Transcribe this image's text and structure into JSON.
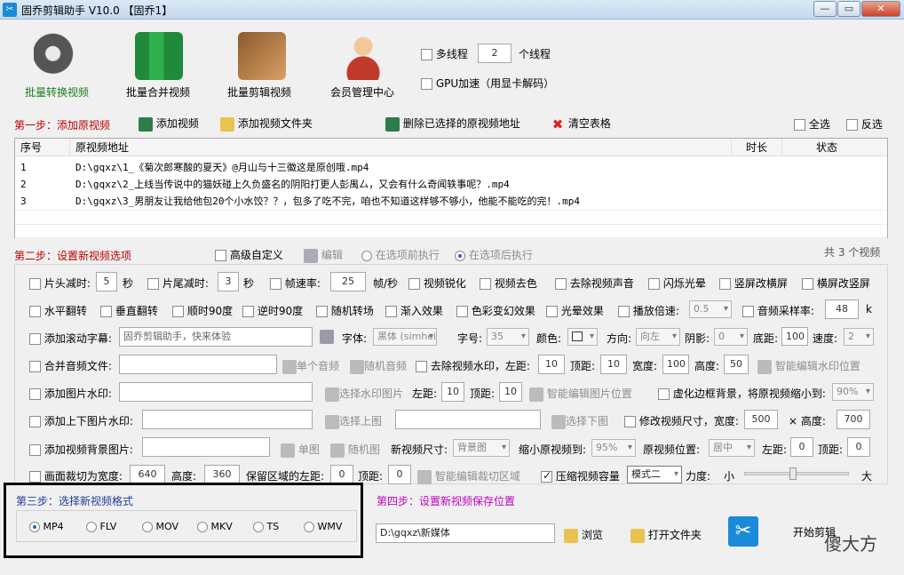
{
  "window": {
    "title": "固乔剪辑助手 V10.0 【固乔1】"
  },
  "topnav": [
    {
      "label": "批量转换视频",
      "icon": "film-reel-icon",
      "color": "#1a7f1a"
    },
    {
      "label": "批量合并视频",
      "icon": "merge-grid-icon",
      "color": "#000000"
    },
    {
      "label": "批量剪辑视频",
      "icon": "film-cut-icon",
      "color": "#000000"
    },
    {
      "label": "会员管理中心",
      "icon": "users-icon",
      "color": "#000000"
    }
  ],
  "thread": {
    "multithread_label": "多线程",
    "count": "2",
    "count_unit": "个线程",
    "gpu_label": "GPU加速（用显卡解码）"
  },
  "step1": {
    "prefix": "第一步：",
    "label": "添加原视频",
    "add_video": "添加视频",
    "add_folder": "添加视频文件夹",
    "delete_selected": "删除已选择的原视频地址",
    "clear_table": "清空表格",
    "select_all": "全选",
    "invert": "反选"
  },
  "table": {
    "headers": [
      "序号",
      "原视频地址",
      "时长",
      "状态"
    ],
    "rows": [
      {
        "idx": "1",
        "path": "D:\\gqxz\\1_《菊次郎寒酸的夏天》@月山与十三徽这是原创哦.mp4",
        "duration": "",
        "status": ""
      },
      {
        "idx": "2",
        "path": "D:\\gqxz\\2_上线当传说中的猫妖碰上久负盛名的阴阳打更人彭禺厶，又会有什么奇闻轶事呢？.mp4",
        "duration": "",
        "status": ""
      },
      {
        "idx": "3",
        "path": "D:\\gqxz\\3_男朋友让我给他包20个小水饺？？，包多了吃不完，咱也不知道这样够不够小，他能不能吃的完！.mp4",
        "duration": "",
        "status": ""
      }
    ]
  },
  "step2": {
    "prefix": "第二步：",
    "label": "设置新视频选项",
    "advanced": "高级自定义",
    "edit": "编辑",
    "before": "在选项前执行",
    "after": "在选项后执行",
    "count": "共 3 个视频"
  },
  "row1": {
    "head_trim": "片头减时:",
    "head_val": "5",
    "sec": "秒",
    "tail_trim": "片尾减时:",
    "tail_val": "3",
    "sec2": "秒",
    "fps": "帧速率:",
    "fps_val": "25",
    "fps_unit": "帧/秒",
    "sharpen": "视频锐化",
    "decolor": "视频去色",
    "remove_audio": "去除视频声音",
    "flash": "闪烁光晕",
    "v2h": "竖屏改横屏",
    "h2v": "横屏改竖屏"
  },
  "row2": {
    "hflip": "水平翻转",
    "vflip": "垂直翻转",
    "cw90": "顺时90度",
    "ccw90": "逆时90度",
    "random_trans": "随机转场",
    "fade_in": "渐入效果",
    "color_change": "色彩变幻效果",
    "halo": "光晕效果",
    "speed": "播放倍速:",
    "speed_val": "0.5",
    "sample": "音频采样率:",
    "sample_val": "48",
    "sample_unit": "k"
  },
  "row3": {
    "subtitle": "添加滚动字幕:",
    "subtitle_val": "固乔剪辑助手，快来体验",
    "font": "字体:",
    "font_val": "黑体 (simhei)",
    "size": "字号:",
    "size_val": "35",
    "color": "颜色:",
    "direction": "方向:",
    "direction_val": "向左",
    "shadow": "阴影:",
    "shadow_val": "0",
    "bottom": "底距:",
    "bottom_val": "100",
    "speed": "速度:",
    "speed_val": "2"
  },
  "row4": {
    "merge_audio": "合并音频文件:",
    "single_audio": "单个音频",
    "random_audio": "随机音频",
    "remove_wm": "去除视频水印，左距:",
    "left_val": "10",
    "top": "顶距:",
    "top_val": "10",
    "width": "宽度:",
    "width_val": "100",
    "height": "高度:",
    "height_val": "50",
    "smart_wm": "智能编辑水印位置"
  },
  "row5": {
    "img_wm": "添加图片水印:",
    "choose_wm": "选择水印图片",
    "left": "左距:",
    "left_val": "10",
    "top": "顶距:",
    "top_val": "10",
    "smart_img": "智能编辑图片位置",
    "blur_border": "虚化边框背景，将原视频缩小到:",
    "shrink_val": "90%"
  },
  "row6": {
    "tb_wm": "添加上下图片水印:",
    "choose_top": "选择上图",
    "choose_bottom": "选择下图",
    "resize": "修改视频尺寸，宽度:",
    "w_val": "500",
    "h": "高度:",
    "h_val": "700"
  },
  "row7": {
    "bg_img": "添加视频背景图片:",
    "single": "单图",
    "random": "随机图",
    "new_size": "新视频尺寸:",
    "new_size_val": "背景图",
    "shrink": "缩小原视频到:",
    "shrink_val": "95%",
    "pos": "原视频位置:",
    "pos_val": "居中",
    "left": "左距:",
    "left_val": "0",
    "top": "顶距:",
    "top_val": "0"
  },
  "row8": {
    "crop": "画面裁切为宽度:",
    "crop_w": "640",
    "h": "高度:",
    "crop_h": "360",
    "keep_left": "保留区域的左距:",
    "keep_left_val": "0",
    "top": "顶距:",
    "top_val": "0",
    "smart_crop": "智能编辑裁切区域",
    "compress": "压缩视频容量",
    "mode": "模式二",
    "force": "力度:",
    "small": "小",
    "large": "大"
  },
  "step3": {
    "title": "第三步：选择新视频格式",
    "formats": [
      "MP4",
      "FLV",
      "MOV",
      "MKV",
      "TS",
      "WMV"
    ],
    "selected": "MP4"
  },
  "step4": {
    "title": "第四步：设置新视频保存位置",
    "path": "D:\\gqxz\\新媒体",
    "browse": "浏览",
    "open_folder": "打开文件夹",
    "start": "开始剪辑"
  },
  "watermark": {
    "text": "傻大方"
  }
}
